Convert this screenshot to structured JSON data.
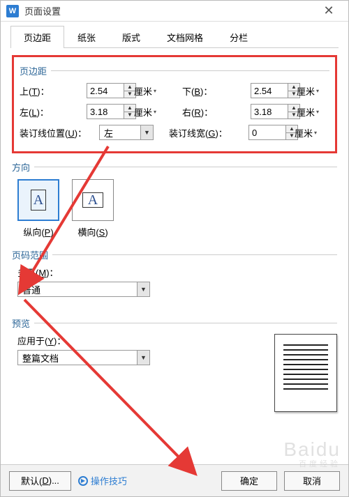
{
  "titlebar": {
    "app_icon": "W",
    "title": "页面设置"
  },
  "tabs": {
    "margins": "页边距",
    "paper": "纸张",
    "layout": "版式",
    "grid": "文档网格",
    "columns": "分栏"
  },
  "margins": {
    "group_label": "页边距",
    "top_label": "上(T)：",
    "top_value": "2.54",
    "bottom_label": "下(B)：",
    "bottom_value": "2.54",
    "left_label": "左(L)：",
    "left_value": "3.18",
    "right_label": "右(R)：",
    "right_value": "3.18",
    "gutter_pos_label": "装订线位置(U)：",
    "gutter_pos_value": "左",
    "gutter_width_label": "装订线宽(G)：",
    "gutter_width_value": "0",
    "unit": "厘米"
  },
  "orientation": {
    "group_label": "方向",
    "portrait": "纵向(P)",
    "landscape": "横向(S)"
  },
  "page_range": {
    "group_label": "页码范围",
    "multi_label": "多页(M)：",
    "multi_value": "普通"
  },
  "preview": {
    "group_label": "预览",
    "apply_label": "应用于(Y)：",
    "apply_value": "整篇文档"
  },
  "footer": {
    "default_btn": "默认(D)...",
    "tips": "操作技巧",
    "ok": "确定",
    "cancel": "取消"
  },
  "watermark": {
    "brand": "Baidu",
    "sub": "百度经验"
  }
}
